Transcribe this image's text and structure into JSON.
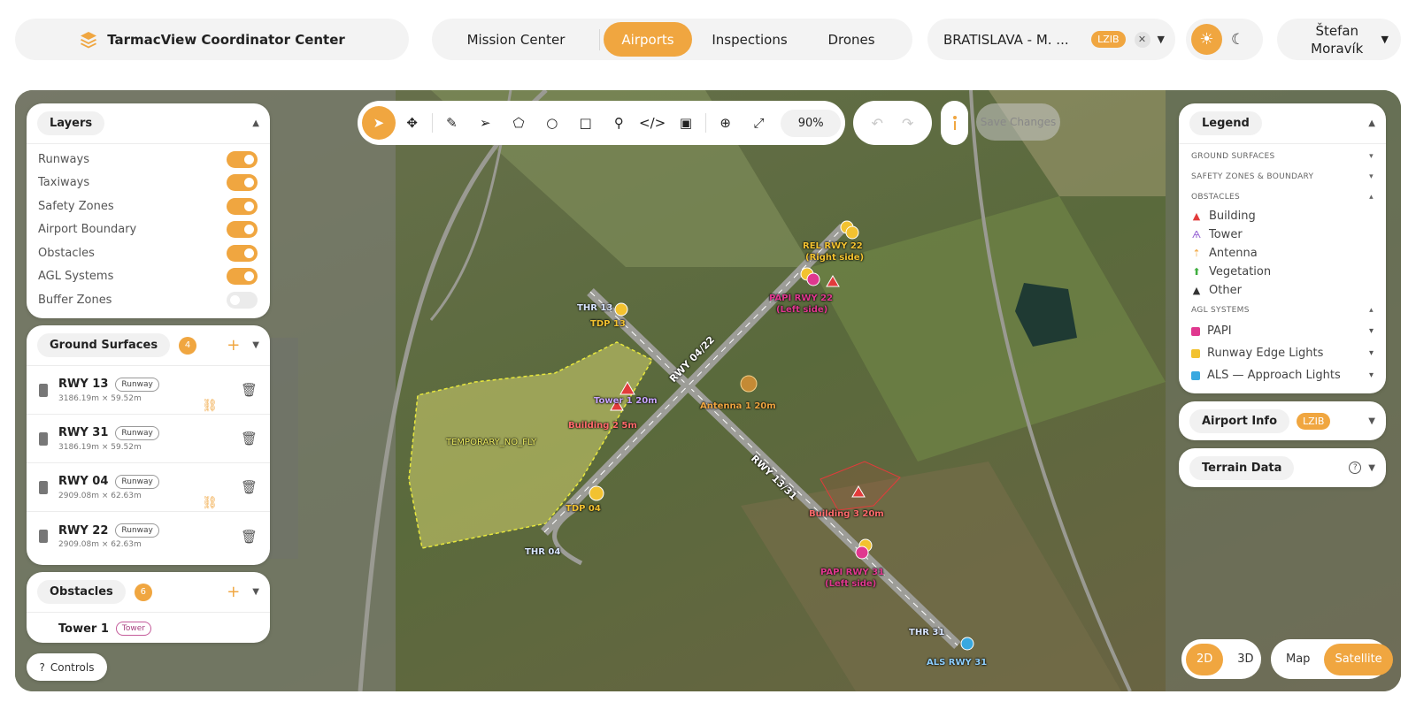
{
  "brand": {
    "title": "TarmacView Coordinator Center"
  },
  "nav": {
    "tabs": [
      "Mission Center",
      "Airports",
      "Inspections",
      "Drones"
    ]
  },
  "airport_select": {
    "name": "BRATISLAVA - M. ...",
    "code": "LZIB"
  },
  "user": {
    "first": "Štefan",
    "last": "Moravík"
  },
  "layers": {
    "title": "Layers",
    "items": [
      {
        "label": "Runways",
        "on": true
      },
      {
        "label": "Taxiways",
        "on": true
      },
      {
        "label": "Safety Zones",
        "on": true
      },
      {
        "label": "Airport Boundary",
        "on": true
      },
      {
        "label": "Obstacles",
        "on": true
      },
      {
        "label": "AGL Systems",
        "on": true
      },
      {
        "label": "Buffer Zones",
        "on": false
      }
    ]
  },
  "ground": {
    "title": "Ground Surfaces",
    "count": "4",
    "rows": [
      {
        "name": "RWY 13",
        "tag": "Runway",
        "dims": "3186.19m × 59.52m"
      },
      {
        "name": "RWY 31",
        "tag": "Runway",
        "dims": "3186.19m × 59.52m"
      },
      {
        "name": "RWY 04",
        "tag": "Runway",
        "dims": "2909.08m × 62.63m"
      },
      {
        "name": "RWY 22",
        "tag": "Runway",
        "dims": "2909.08m × 62.63m"
      }
    ]
  },
  "obstacles_panel": {
    "title": "Obstacles",
    "count": "6",
    "first": {
      "name": "Tower 1",
      "tag": "Tower"
    }
  },
  "controls": {
    "label": "Controls"
  },
  "toolbar": {
    "zoom": "90%"
  },
  "save": {
    "label": "Save Changes"
  },
  "legend": {
    "title": "Legend",
    "sections": {
      "ground": "GROUND SURFACES",
      "safety": "SAFETY ZONES & BOUNDARY",
      "obstacles": "OBSTACLES",
      "agl": "AGL SYSTEMS"
    },
    "obstacles": [
      "Building",
      "Tower",
      "Antenna",
      "Vegetation",
      "Other"
    ],
    "agl": [
      "PAPI",
      "Runway Edge Lights",
      "ALS — Approach Lights"
    ],
    "colors": {
      "papi": "#e0388f",
      "edge": "#f2c230",
      "als": "#38a8e0",
      "building": "#e23b3b",
      "tower": "#9b6ad6",
      "antenna": "#f0a640",
      "vegetation": "#3fae3f",
      "other": "#333333"
    }
  },
  "airport_info": {
    "title": "Airport Info",
    "code": "LZIB"
  },
  "terrain": {
    "title": "Terrain Data"
  },
  "view_mode": {
    "options": [
      "2D",
      "3D"
    ],
    "active": "2D"
  },
  "map_type": {
    "options": [
      "Map",
      "Satellite"
    ],
    "active": "Satellite"
  },
  "map_labels": {
    "rel22": "REL RWY 22",
    "rel22b": "(Right side)",
    "papi22": "PAPI RWY 22",
    "papi22b": "(Left side)",
    "thr13": "THR 13",
    "tdp13": "TDP 13",
    "tower1": "Tower 1  20m",
    "building2": "Building 2  5m",
    "antenna1": "Antenna 1  20m",
    "rwy0422": "RWY 04/22",
    "rwy1331": "RWY 13/31",
    "nofly": "TEMPORARY_NO_FLY",
    "tdp04": "TDP 04",
    "thr04": "THR 04",
    "building3": "Building 3  20m",
    "papi31": "PAPI RWY 31",
    "papi31b": "(Left side)",
    "thr31": "THR 31",
    "als31": "ALS RWY 31"
  }
}
